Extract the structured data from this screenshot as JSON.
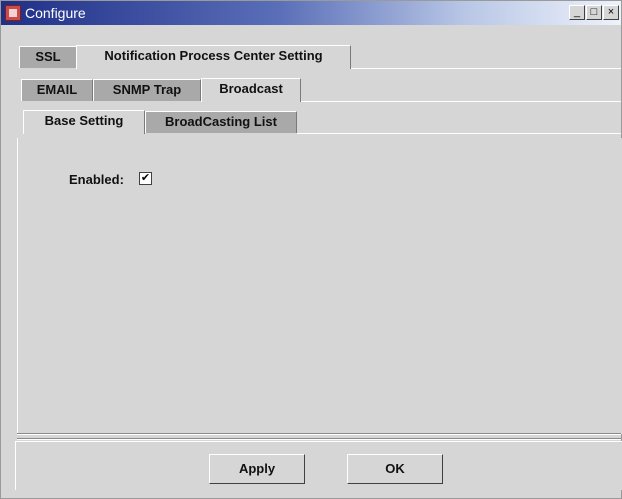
{
  "window": {
    "title": "Configure",
    "controls": {
      "minimize": "_",
      "maximize": "□",
      "close": "×"
    }
  },
  "tabs_level1": [
    "SSL",
    "Notification Process Center Setting"
  ],
  "tabs_level2": [
    "EMAIL",
    "SNMP Trap",
    "Broadcast"
  ],
  "tabs_level3": [
    "Base Setting",
    "BroadCasting List"
  ],
  "form": {
    "enabled_label": "Enabled:",
    "enabled_checked": true,
    "check_mark": "✔"
  },
  "buttons": {
    "apply": "Apply",
    "ok": "OK"
  },
  "icons": {
    "app": "configure-app-icon"
  }
}
